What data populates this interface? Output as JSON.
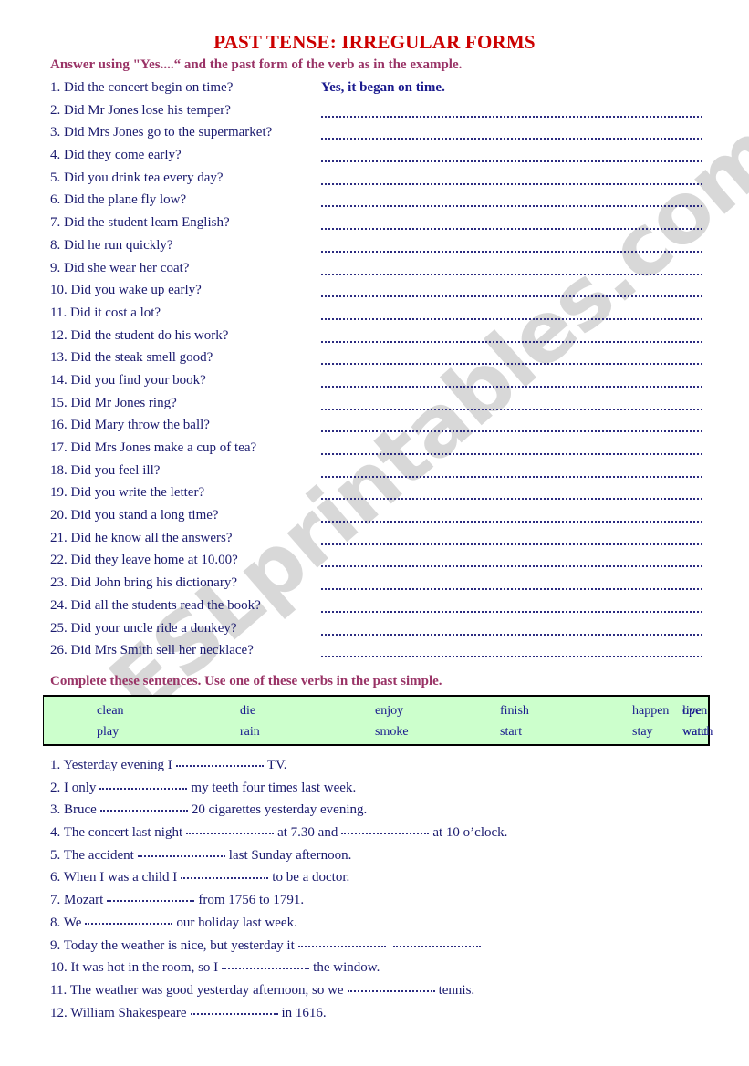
{
  "document": {
    "title": "PAST TENSE: IRREGULAR FORMS",
    "watermark": "ESLprintables.com"
  },
  "section1": {
    "instruction": "Answer using \"Yes....“ and the past form of the verb as in the example.",
    "example_answer": "Yes, it began on time.",
    "questions": [
      "1. Did the concert begin on time?",
      "2. Did Mr Jones lose his temper?",
      "3. Did Mrs Jones go to the supermarket?",
      "4. Did they come early?",
      "5. Did you drink tea every day?",
      "6. Did the plane fly low?",
      "7. Did the student learn English?",
      "8. Did he run quickly?",
      "9. Did she wear her coat?",
      "10. Did you wake up early?",
      "11. Did it cost a lot?",
      "12. Did the student do his work?",
      "13. Did the steak smell good?",
      "14. Did you find your book?",
      "15. Did Mr Jones ring?",
      "16. Did Mary throw the ball?",
      "17. Did Mrs Jones make a cup of tea?",
      "18. Did you feel ill?",
      "19. Did you write the letter?",
      "20. Did you stand a long time?",
      "21. Did he know all the answers?",
      "22. Did they leave home at 10.00?",
      "23. Did John bring his dictionary?",
      "24. Did all the students read the book?",
      "25. Did your uncle ride a donkey?",
      "26. Did Mrs Smith sell her necklace?"
    ]
  },
  "section2": {
    "instruction": "Complete these sentences. Use one of these verbs in the past simple.",
    "verbs_row_1": [
      "clean",
      "die",
      "enjoy",
      "finish",
      "happen",
      "live",
      "open"
    ],
    "verbs_row_2": [
      "play",
      "rain",
      "smoke",
      "start",
      "stay",
      "want",
      "watch"
    ],
    "sentences": [
      {
        "number": "1.",
        "parts": [
          "Yesterday evening I",
          "TV."
        ]
      },
      {
        "number": "2.",
        "parts": [
          "I only",
          "my teeth four times last week."
        ]
      },
      {
        "number": "3.",
        "parts": [
          "Bruce",
          "20 cigarettes yesterday evening."
        ]
      },
      {
        "number": "4.",
        "parts": [
          "The concert last night",
          "at 7.30 and",
          "at 10 o’clock."
        ]
      },
      {
        "number": "5.",
        "parts": [
          "The accident",
          "last Sunday afternoon."
        ]
      },
      {
        "number": "6.",
        "parts": [
          "When I was a child I",
          "to be a doctor."
        ]
      },
      {
        "number": "7.",
        "parts": [
          "Mozart",
          "from 1756 to 1791."
        ]
      },
      {
        "number": "8.",
        "parts": [
          "We",
          "our holiday last week."
        ]
      },
      {
        "number": "9.",
        "parts": [
          "Today the weather is nice, but yesterday it",
          ""
        ]
      },
      {
        "number": "10.",
        "parts": [
          "It was hot in the room, so I",
          "the window."
        ]
      },
      {
        "number": "11.",
        "parts": [
          "The weather was good yesterday afternoon, so we",
          "tennis."
        ]
      },
      {
        "number": "12.",
        "parts": [
          "William Shakespeare",
          "in 1616."
        ]
      }
    ]
  },
  "colors": {
    "title": "#cc0000",
    "instruction": "#993366",
    "body_text": "#1a1a6e",
    "verb_box_fill": "#ccffcc",
    "watermark": "#cccccc"
  }
}
